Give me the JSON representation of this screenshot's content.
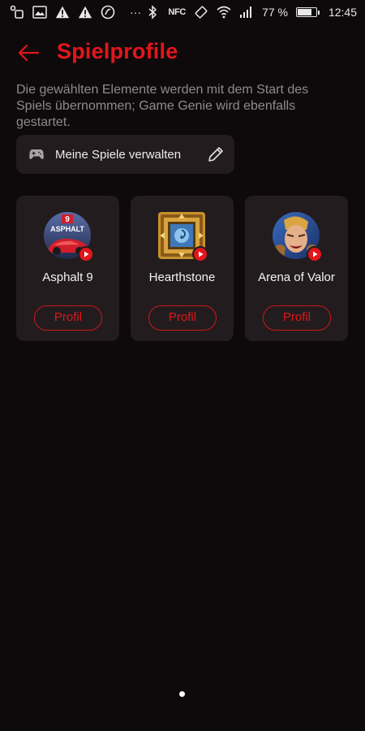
{
  "status_bar": {
    "nfc_label": "NFC",
    "battery_text": "77 %",
    "battery_level": 0.77,
    "time": "12:45",
    "more_dots": "···",
    "icons_left": [
      "notification-icon",
      "image-icon",
      "warning-icon",
      "warning-icon",
      "app-icon"
    ],
    "icons_right": [
      "bluetooth-icon",
      "nfc-icon",
      "rotate-icon",
      "wifi-icon",
      "signal-icon",
      "battery-icon"
    ]
  },
  "header": {
    "title": "Spielprofile",
    "back_icon": "arrow-left-icon"
  },
  "description": "Die gewählten Elemente werden mit dem Start des Spiels übernommen; Game Genie wird ebenfalls gestartet.",
  "manage": {
    "label": "Meine Spiele verwalten",
    "icon": "gamepad-icon",
    "edit_icon": "pencil-icon"
  },
  "games": [
    {
      "name": "Asphalt 9",
      "button": "Profil",
      "icon_text": "ASPHALT",
      "icon_number": "9"
    },
    {
      "name": "Hearthstone",
      "button": "Profil"
    },
    {
      "name": "Arena of Valor",
      "button": "Profil"
    }
  ],
  "colors": {
    "accent": "#e3161b",
    "background": "#0e0a0b",
    "card": "#221c1e",
    "text_secondary": "#8f8a8b"
  },
  "pager": {
    "pages": 1,
    "current": 1
  }
}
